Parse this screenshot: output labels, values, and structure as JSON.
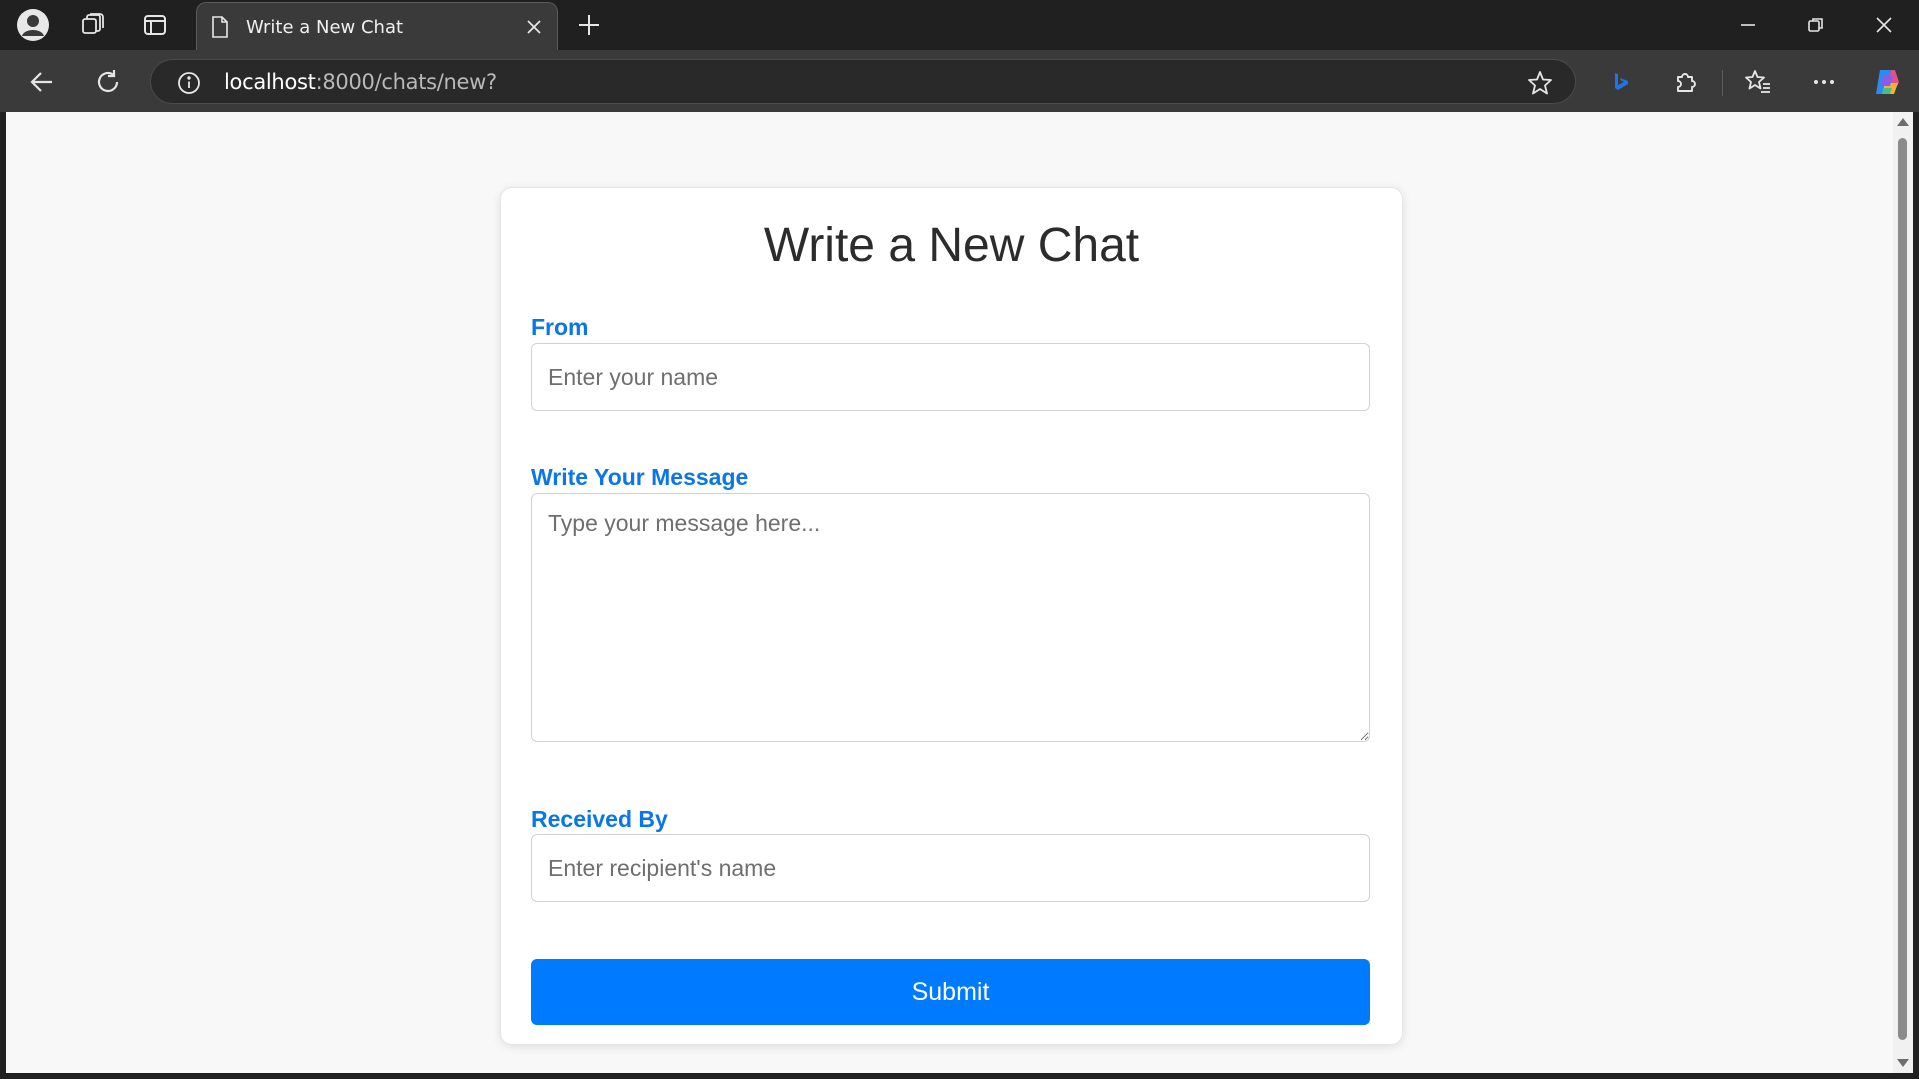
{
  "browser": {
    "tab": {
      "title": "Write a New Chat"
    },
    "address": {
      "host": "localhost",
      "path": ":8000/chats/new?"
    }
  },
  "page": {
    "title": "Write a New Chat",
    "from": {
      "label": "From",
      "placeholder": "Enter your name",
      "value": ""
    },
    "message": {
      "label": "Write Your Message",
      "placeholder": "Type your message here...",
      "value": ""
    },
    "received_by": {
      "label": "Received By",
      "placeholder": "Enter recipient's name",
      "value": ""
    },
    "submit_label": "Submit"
  },
  "colors": {
    "label_blue": "#0b76e8",
    "button_blue": "#007bff",
    "page_bg": "#f8f8f8",
    "chrome_dark": "#202020",
    "toolbar": "#3a3a3a"
  },
  "icons": [
    "profile-icon",
    "workspaces-icon",
    "tab-actions-icon",
    "document-icon",
    "close-icon",
    "plus-icon",
    "minimize-icon",
    "restore-icon",
    "window-close-icon",
    "back-icon",
    "refresh-icon",
    "info-icon",
    "star-icon",
    "bing-icon",
    "extensions-icon",
    "favorites-icon",
    "more-icon",
    "copilot-icon"
  ]
}
